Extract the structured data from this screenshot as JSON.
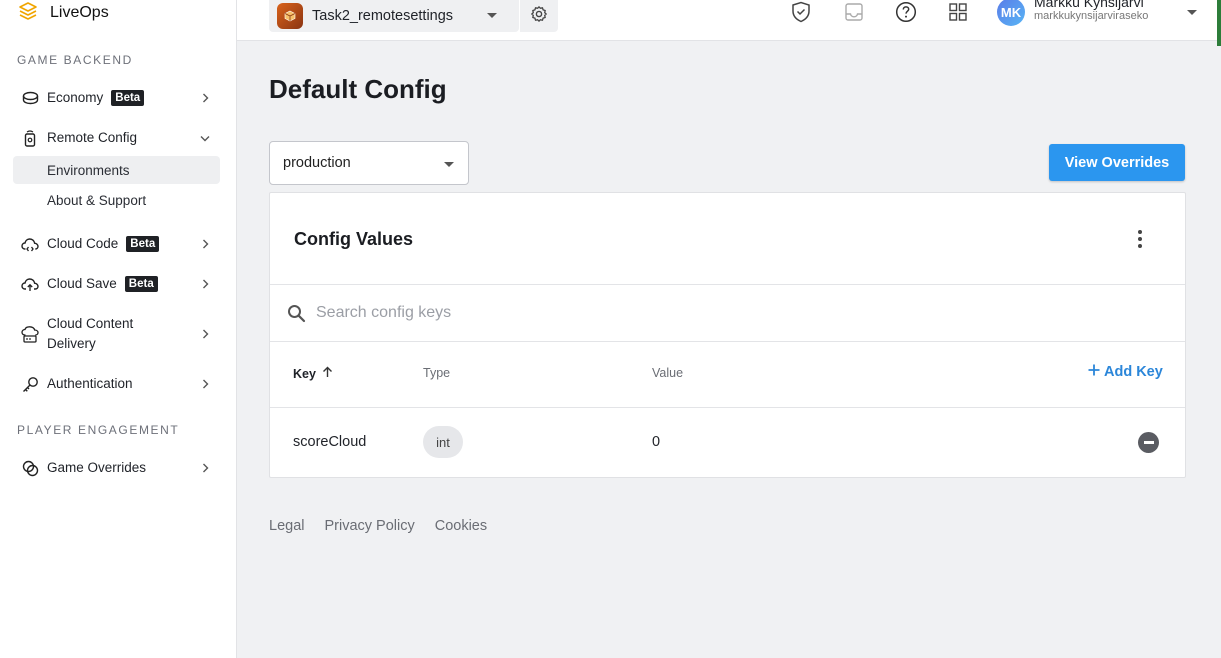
{
  "brand": {
    "name": "LiveOps"
  },
  "sidebar": {
    "sections": [
      {
        "title": "GAME BACKEND"
      },
      {
        "title": "PLAYER ENGAGEMENT"
      }
    ],
    "items": [
      {
        "label": "Economy",
        "badge": "Beta",
        "icon": "coin-icon"
      },
      {
        "label": "Remote Config",
        "icon": "remote-config-icon",
        "expanded": true
      },
      {
        "label": "Cloud Code",
        "badge": "Beta",
        "icon": "cloud-code-icon"
      },
      {
        "label": "Cloud Save",
        "badge": "Beta",
        "icon": "cloud-save-icon"
      },
      {
        "label": "Cloud Content Delivery",
        "icon": "cloud-content-icon"
      },
      {
        "label": "Authentication",
        "icon": "key-icon"
      },
      {
        "label": "Game Overrides",
        "icon": "game-overrides-icon"
      }
    ],
    "sub_items": [
      {
        "label": "Environments",
        "active": true
      },
      {
        "label": "About & Support",
        "active": false
      }
    ]
  },
  "topbar": {
    "project": "Task2_remotesettings",
    "user": {
      "initials": "MK",
      "name": "Markku Kynsijärvi",
      "email": "markkukynsijarviraseko"
    }
  },
  "main": {
    "title": "Default Config",
    "environment": "production",
    "view_overrides_label": "View Overrides",
    "card": {
      "title": "Config Values",
      "search_placeholder": "Search config keys",
      "columns": {
        "key": "Key",
        "type": "Type",
        "value": "Value"
      },
      "add_key_label": "Add Key",
      "rows": [
        {
          "key": "scoreCloud",
          "type": "int",
          "value": "0"
        }
      ]
    }
  },
  "footer": {
    "links": [
      "Legal",
      "Privacy Policy",
      "Cookies"
    ]
  },
  "colors": {
    "primary": "#2b96ef",
    "link": "#2b86d9",
    "badge": "#1f2125"
  }
}
